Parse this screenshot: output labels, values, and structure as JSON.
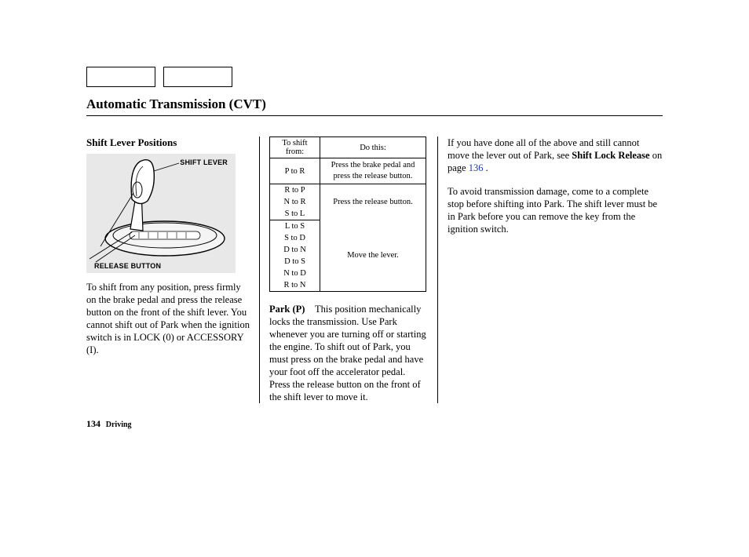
{
  "page_title": "Automatic Transmission (CVT)",
  "col1": {
    "heading": "Shift Lever Positions",
    "diagram": {
      "label_shift_lever": "SHIFT LEVER",
      "label_release_button": "RELEASE BUTTON"
    },
    "para1": "To shift from any position, press firmly on the brake pedal and press the release button on the front of the shift lever. You cannot shift out of Park when the ignition switch is in LOCK (0) or ACCESSORY (I)."
  },
  "col2": {
    "table": {
      "head_left": "To shift from:",
      "head_right": "Do this:",
      "groups": [
        {
          "shifts": [
            "P to R"
          ],
          "action": "Press the brake pedal and press the release button."
        },
        {
          "shifts": [
            "R to P",
            "N to R",
            "S to L"
          ],
          "action": "Press the release button."
        },
        {
          "shifts": [
            "L to S",
            "S to D",
            "D to N",
            "D to S",
            "N to D",
            "R to N"
          ],
          "action": "Move the lever."
        }
      ]
    },
    "park_label": "Park (P)",
    "park_text": "This position mechani­cally locks the transmission. Use Park whenever you are turning off or starting the engine. To shift out of Park, you must press on the brake pedal and have your foot off the accelerator pedal. Press the release button on the front of the shift lever to move it."
  },
  "col3": {
    "para1_a": "If you have done all of the above and still cannot move the lever out of Park, see ",
    "para1_bold": "Shift Lock Release",
    "para1_b": " on page ",
    "page_ref": "136",
    "para1_c": " .",
    "para2": "To avoid transmission damage, come to a complete stop before shifting into Park. The shift lever must be in Park before you can remove the key from the ignition switch."
  },
  "footer": {
    "page_number": "134",
    "section": "Driving"
  }
}
